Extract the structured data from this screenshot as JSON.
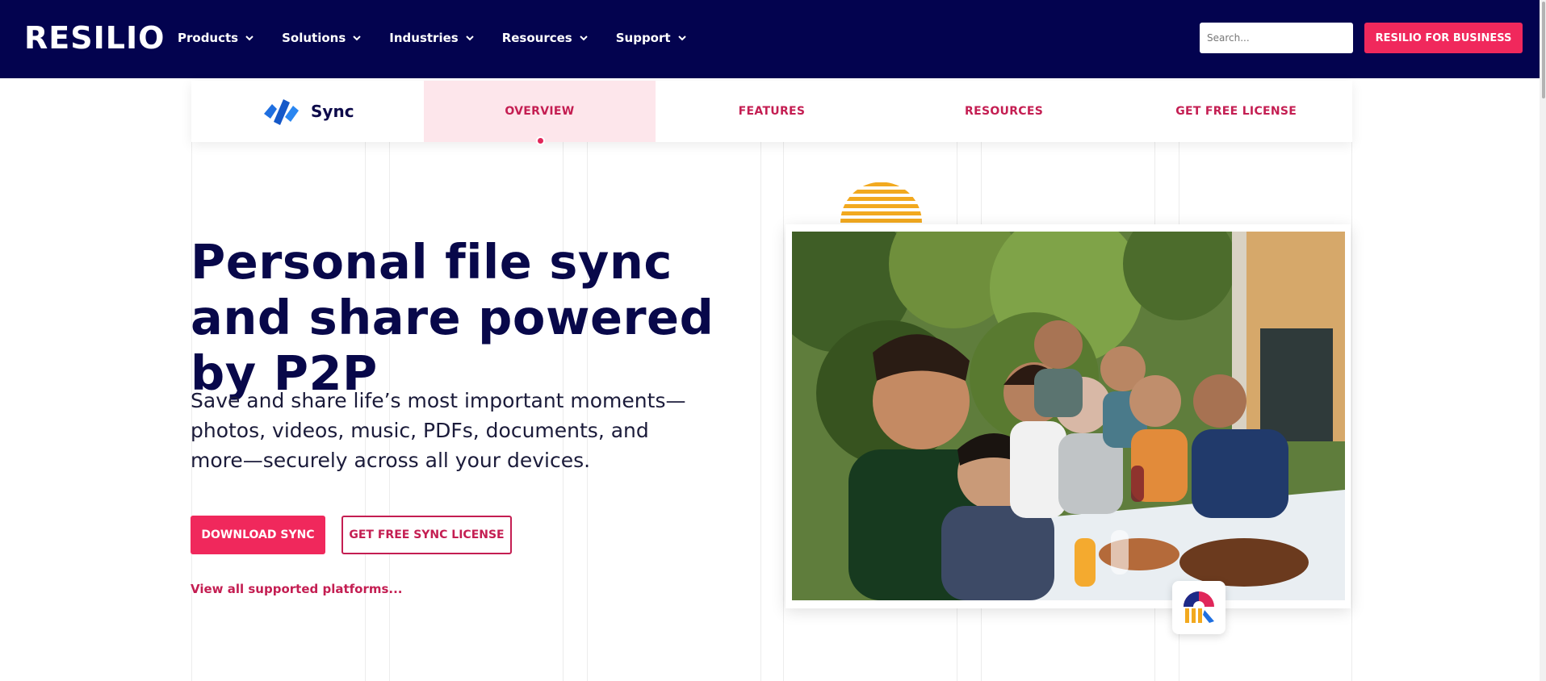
{
  "header": {
    "logo": "RESILIO",
    "nav": [
      {
        "label": "Products"
      },
      {
        "label": "Solutions"
      },
      {
        "label": "Industries"
      },
      {
        "label": "Resources"
      },
      {
        "label": "Support"
      }
    ],
    "search_placeholder": "Search...",
    "business_button": "RESILIO FOR BUSINESS"
  },
  "subnav": {
    "brand": "Sync",
    "brand_icon": "sync-logo-icon",
    "tabs": [
      {
        "label": "OVERVIEW",
        "active": true
      },
      {
        "label": "FEATURES",
        "active": false
      },
      {
        "label": "RESOURCES",
        "active": false
      },
      {
        "label": "GET FREE LICENSE",
        "active": false
      }
    ]
  },
  "hero": {
    "headline": "Personal file sync and share powered by P2P",
    "subtext": "Save and share life’s most important moments—photos, videos, music, PDFs, documents, and more—securely across all your devices.",
    "primary_button": "DOWNLOAD SYNC",
    "secondary_button": "GET FREE SYNC LICENSE",
    "platforms_link": "View all supported platforms..."
  },
  "colors": {
    "navy": "#03034f",
    "accent": "#f0285c",
    "accent_dark": "#c41e52",
    "active_tab_bg": "#fde6eb",
    "sun": "#f2a91f"
  }
}
